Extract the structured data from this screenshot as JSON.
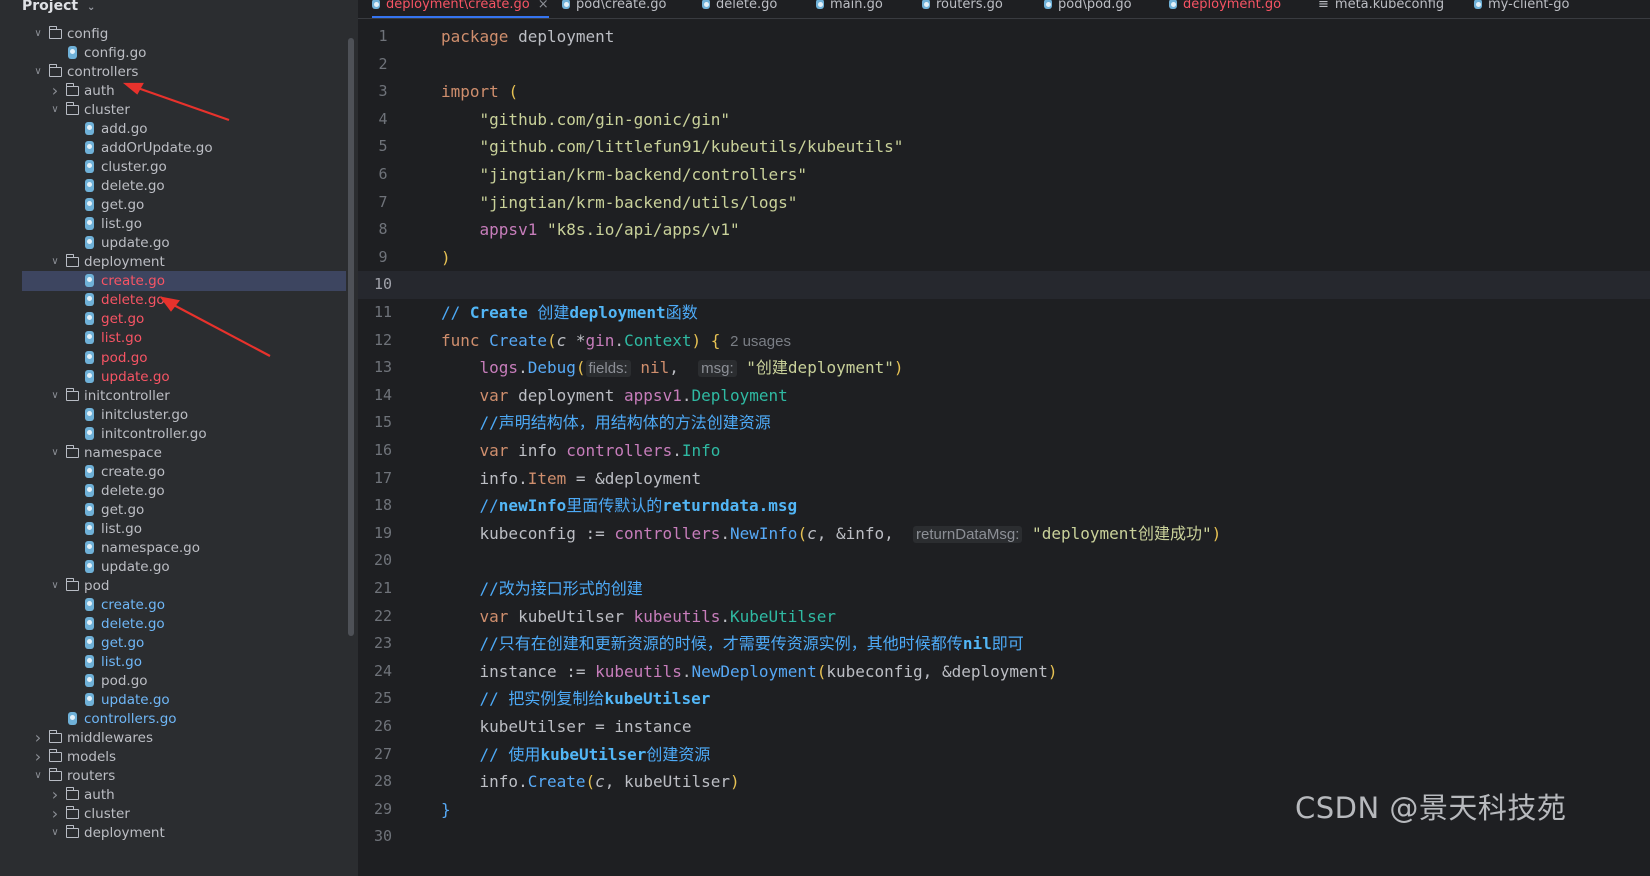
{
  "project": {
    "title": "Project",
    "tree": [
      {
        "label": "config",
        "type": "folder",
        "depth": 1,
        "expanded": true
      },
      {
        "label": "config.go",
        "type": "go",
        "depth": 2
      },
      {
        "label": "controllers",
        "type": "folder",
        "depth": 1,
        "expanded": true
      },
      {
        "label": "auth",
        "type": "folder",
        "depth": 2,
        "expanded": false
      },
      {
        "label": "cluster",
        "type": "folder",
        "depth": 2,
        "expanded": true
      },
      {
        "label": "add.go",
        "type": "go",
        "depth": 3
      },
      {
        "label": "addOrUpdate.go",
        "type": "go",
        "depth": 3
      },
      {
        "label": "cluster.go",
        "type": "go",
        "depth": 3
      },
      {
        "label": "delete.go",
        "type": "go",
        "depth": 3
      },
      {
        "label": "get.go",
        "type": "go",
        "depth": 3
      },
      {
        "label": "list.go",
        "type": "go",
        "depth": 3
      },
      {
        "label": "update.go",
        "type": "go",
        "depth": 3
      },
      {
        "label": "deployment",
        "type": "folder",
        "depth": 2,
        "expanded": true
      },
      {
        "label": "create.go",
        "type": "go",
        "depth": 3,
        "color": "red",
        "selected": true
      },
      {
        "label": "delete.go",
        "type": "go",
        "depth": 3,
        "color": "red"
      },
      {
        "label": "get.go",
        "type": "go",
        "depth": 3,
        "color": "red"
      },
      {
        "label": "list.go",
        "type": "go",
        "depth": 3,
        "color": "red"
      },
      {
        "label": "pod.go",
        "type": "go",
        "depth": 3,
        "color": "red"
      },
      {
        "label": "update.go",
        "type": "go",
        "depth": 3,
        "color": "red"
      },
      {
        "label": "initcontroller",
        "type": "folder",
        "depth": 2,
        "expanded": true
      },
      {
        "label": "initcluster.go",
        "type": "go",
        "depth": 3
      },
      {
        "label": "initcontroller.go",
        "type": "go",
        "depth": 3
      },
      {
        "label": "namespace",
        "type": "folder",
        "depth": 2,
        "expanded": true
      },
      {
        "label": "create.go",
        "type": "go",
        "depth": 3
      },
      {
        "label": "delete.go",
        "type": "go",
        "depth": 3
      },
      {
        "label": "get.go",
        "type": "go",
        "depth": 3
      },
      {
        "label": "list.go",
        "type": "go",
        "depth": 3
      },
      {
        "label": "namespace.go",
        "type": "go",
        "depth": 3
      },
      {
        "label": "update.go",
        "type": "go",
        "depth": 3
      },
      {
        "label": "pod",
        "type": "folder",
        "depth": 2,
        "expanded": true
      },
      {
        "label": "create.go",
        "type": "go",
        "depth": 3,
        "color": "blue"
      },
      {
        "label": "delete.go",
        "type": "go",
        "depth": 3,
        "color": "blue"
      },
      {
        "label": "get.go",
        "type": "go",
        "depth": 3,
        "color": "blue"
      },
      {
        "label": "list.go",
        "type": "go",
        "depth": 3,
        "color": "blue"
      },
      {
        "label": "pod.go",
        "type": "go",
        "depth": 3
      },
      {
        "label": "update.go",
        "type": "go",
        "depth": 3,
        "color": "blue"
      },
      {
        "label": "controllers.go",
        "type": "go",
        "depth": 2,
        "color": "blue"
      },
      {
        "label": "middlewares",
        "type": "folder",
        "depth": 1,
        "expanded": false
      },
      {
        "label": "models",
        "type": "folder",
        "depth": 1,
        "expanded": false
      },
      {
        "label": "routers",
        "type": "folder",
        "depth": 1,
        "expanded": true
      },
      {
        "label": "auth",
        "type": "folder",
        "depth": 2,
        "expanded": false
      },
      {
        "label": "cluster",
        "type": "folder",
        "depth": 2,
        "expanded": false
      },
      {
        "label": "deployment",
        "type": "folder",
        "depth": 2,
        "expanded": true
      }
    ]
  },
  "tabs": [
    {
      "label": "deployment\\create.go",
      "color": "red",
      "active": true,
      "closable": true,
      "icon": "go-file-icon"
    },
    {
      "label": "pod\\create.go",
      "color": "default",
      "icon": "go-file-icon"
    },
    {
      "label": "delete.go",
      "color": "default",
      "icon": "go-file-icon"
    },
    {
      "label": "main.go",
      "color": "default",
      "icon": "go-file-icon"
    },
    {
      "label": "routers.go",
      "color": "default",
      "icon": "go-file-icon"
    },
    {
      "label": "pod\\pod.go",
      "color": "default",
      "icon": "go-file-icon"
    },
    {
      "label": "deployment.go",
      "color": "red",
      "icon": "go-file-icon"
    },
    {
      "label": "meta.kubeconfig",
      "color": "default",
      "icon": "text-file-icon"
    },
    {
      "label": "my-client-go",
      "color": "default",
      "icon": "go-file-icon"
    }
  ],
  "editor": {
    "current_line": 10,
    "lines": [
      {
        "n": "1",
        "segs": [
          [
            "k",
            "package "
          ],
          [
            "",
            "deployment"
          ]
        ]
      },
      {
        "n": "2",
        "segs": []
      },
      {
        "n": "3",
        "segs": [
          [
            "k",
            "import "
          ],
          [
            "paren",
            "("
          ]
        ]
      },
      {
        "n": "4",
        "segs": [
          [
            "",
            "    "
          ],
          [
            "str",
            "\"github.com/gin-gonic/gin\""
          ]
        ]
      },
      {
        "n": "5",
        "segs": [
          [
            "",
            "    "
          ],
          [
            "str",
            "\"github.com/littlefun91/kubeutils/kubeutils\""
          ]
        ]
      },
      {
        "n": "6",
        "segs": [
          [
            "",
            "    "
          ],
          [
            "str",
            "\"jingtian/krm-backend/controllers\""
          ]
        ]
      },
      {
        "n": "7",
        "segs": [
          [
            "",
            "    "
          ],
          [
            "str",
            "\"jingtian/krm-backend/utils/logs\""
          ]
        ]
      },
      {
        "n": "8",
        "segs": [
          [
            "",
            "    "
          ],
          [
            "pk",
            "appsv1 "
          ],
          [
            "str",
            "\"k8s.io/api/apps/v1\""
          ]
        ]
      },
      {
        "n": "9",
        "segs": [
          [
            "paren",
            ")"
          ]
        ]
      },
      {
        "n": "10",
        "segs": []
      },
      {
        "n": "11",
        "segs": [
          [
            "cm",
            "// "
          ],
          [
            "cmb",
            "Create "
          ],
          [
            "cm",
            "创建"
          ],
          [
            "cmb",
            "deployment"
          ],
          [
            "cm",
            "函数"
          ]
        ]
      },
      {
        "n": "12",
        "segs": [
          [
            "k",
            "func "
          ],
          [
            "fnc",
            "Create"
          ],
          [
            "paren",
            "("
          ],
          [
            "param",
            "c "
          ],
          [
            "",
            "*"
          ],
          [
            "pk",
            "gin"
          ],
          [
            "",
            "."
          ],
          [
            "ty",
            "Context"
          ],
          [
            "paren",
            ")"
          ],
          [
            "",
            " "
          ],
          [
            "paren",
            "{"
          ],
          [
            "",
            " "
          ],
          [
            "usages",
            "2 usages"
          ]
        ]
      },
      {
        "n": "13",
        "segs": [
          [
            "",
            "    "
          ],
          [
            "pk",
            "logs"
          ],
          [
            "",
            "."
          ],
          [
            "fn",
            "Debug"
          ],
          [
            "paren",
            "("
          ],
          [
            "hint",
            "fields:"
          ],
          [
            "k",
            " nil"
          ],
          [
            "",
            ",  "
          ],
          [
            "hint",
            "msg:"
          ],
          [
            "str",
            " \"创建deployment\""
          ],
          [
            "paren",
            ")"
          ]
        ]
      },
      {
        "n": "14",
        "segs": [
          [
            "",
            "    "
          ],
          [
            "k",
            "var "
          ],
          [
            "",
            "deployment "
          ],
          [
            "pk",
            "appsv1"
          ],
          [
            "",
            "."
          ],
          [
            "ty",
            "Deployment"
          ]
        ]
      },
      {
        "n": "15",
        "segs": [
          [
            "",
            "    "
          ],
          [
            "cm",
            "//声明结构体，用结构体的方法创建资源"
          ]
        ]
      },
      {
        "n": "16",
        "segs": [
          [
            "",
            "    "
          ],
          [
            "k",
            "var "
          ],
          [
            "",
            "info "
          ],
          [
            "pk",
            "controllers"
          ],
          [
            "",
            "."
          ],
          [
            "ty",
            "Info"
          ]
        ]
      },
      {
        "n": "17",
        "segs": [
          [
            "",
            "    "
          ],
          [
            "",
            "info."
          ],
          [
            "k",
            "Item"
          ],
          [
            "",
            " = &deployment"
          ]
        ]
      },
      {
        "n": "18",
        "segs": [
          [
            "",
            "    "
          ],
          [
            "cm",
            "//"
          ],
          [
            "cmb",
            "newInfo"
          ],
          [
            "cm",
            "里面传默认的"
          ],
          [
            "cmb",
            "returndata.msg"
          ]
        ]
      },
      {
        "n": "19",
        "segs": [
          [
            "",
            "    "
          ],
          [
            "",
            "kubeconfig := "
          ],
          [
            "pk",
            "controllers"
          ],
          [
            "",
            "."
          ],
          [
            "fn",
            "NewInfo"
          ],
          [
            "paren",
            "("
          ],
          [
            "param",
            "c"
          ],
          [
            "",
            ", &info,  "
          ],
          [
            "hint",
            "returnDataMsg:"
          ],
          [
            "str",
            " \"deployment创建成功\""
          ],
          [
            "paren",
            ")"
          ]
        ]
      },
      {
        "n": "20",
        "segs": []
      },
      {
        "n": "21",
        "segs": [
          [
            "",
            "    "
          ],
          [
            "cm",
            "//改为接口形式的创建"
          ]
        ]
      },
      {
        "n": "22",
        "segs": [
          [
            "",
            "    "
          ],
          [
            "k",
            "var "
          ],
          [
            "",
            "kubeUtilser "
          ],
          [
            "pk",
            "kubeutils"
          ],
          [
            "",
            "."
          ],
          [
            "ty",
            "KubeUtilser"
          ]
        ]
      },
      {
        "n": "23",
        "segs": [
          [
            "",
            "    "
          ],
          [
            "cm",
            "//只有在创建和更新资源的时候，才需要传资源实例，其他时候都传"
          ],
          [
            "cmb",
            "nil"
          ],
          [
            "cm",
            "即可"
          ]
        ]
      },
      {
        "n": "24",
        "segs": [
          [
            "",
            "    "
          ],
          [
            "",
            "instance := "
          ],
          [
            "pk",
            "kubeutils"
          ],
          [
            "",
            "."
          ],
          [
            "fnc",
            "NewDeployment"
          ],
          [
            "paren",
            "("
          ],
          [
            "",
            "kubeconfig, &deployment"
          ],
          [
            "paren",
            ")"
          ]
        ]
      },
      {
        "n": "25",
        "segs": [
          [
            "",
            "    "
          ],
          [
            "cm",
            "// 把实例复制给"
          ],
          [
            "cmb",
            "kubeUtilser"
          ]
        ]
      },
      {
        "n": "26",
        "segs": [
          [
            "",
            "    "
          ],
          [
            "",
            "kubeUtilser = instance"
          ]
        ]
      },
      {
        "n": "27",
        "segs": [
          [
            "",
            "    "
          ],
          [
            "cm",
            "// 使用"
          ],
          [
            "cmb",
            "kubeUtilser"
          ],
          [
            "cm",
            "创建资源"
          ]
        ]
      },
      {
        "n": "28",
        "segs": [
          [
            "",
            "    "
          ],
          [
            "",
            "info."
          ],
          [
            "fn",
            "Create"
          ],
          [
            "paren",
            "("
          ],
          [
            "param",
            "c"
          ],
          [
            "",
            ", kubeUtilser"
          ],
          [
            "paren",
            ")"
          ]
        ]
      },
      {
        "n": "29",
        "segs": [
          [
            "fn",
            "}"
          ]
        ]
      },
      {
        "n": "30",
        "segs": []
      }
    ]
  },
  "watermark": "CSDN @景天科技苑",
  "colors": {
    "annotation_arrow": "#e8322c",
    "selection": "#3d4560",
    "accent": "#3574f0"
  }
}
